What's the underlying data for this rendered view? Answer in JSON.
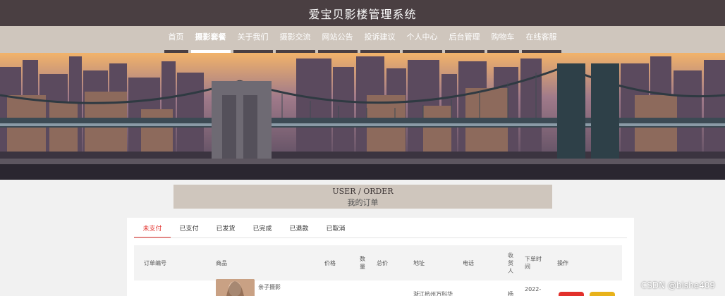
{
  "header": {
    "title": "爱宝贝影楼管理系统"
  },
  "nav": {
    "items": [
      {
        "label": "首页"
      },
      {
        "label": "摄影套餐"
      },
      {
        "label": "关于我们"
      },
      {
        "label": "摄影交流"
      },
      {
        "label": "网站公告"
      },
      {
        "label": "投诉建议"
      },
      {
        "label": "个人中心"
      },
      {
        "label": "后台管理"
      },
      {
        "label": "购物车"
      },
      {
        "label": "在线客服"
      }
    ],
    "active_index": 1
  },
  "section": {
    "title_en": "USER / ORDER",
    "title_zh": "我的订单"
  },
  "tabs": {
    "items": [
      "未支付",
      "已支付",
      "已发货",
      "已完成",
      "已退款",
      "已取消"
    ],
    "active_index": 0
  },
  "table": {
    "headers": {
      "order_no": "订单编号",
      "product": "商品",
      "price": "价格",
      "qty": "数量",
      "total": "总价",
      "address": "地址",
      "phone": "电话",
      "receiver": "收货人",
      "order_time": "下单时间",
      "actions": "操作"
    },
    "row": {
      "product_name": "亲子摄影",
      "address": "浙江杭州万科华",
      "receiver": "杨",
      "order_time": "2022-"
    }
  },
  "colors": {
    "title_bar": "#4a3f42",
    "nav_bar": "#cfc6bd",
    "tab_active": "#e2302b",
    "pay_button": "#e2302b",
    "other_button": "#e8b21a"
  },
  "watermark": "CSDN @bishe409"
}
